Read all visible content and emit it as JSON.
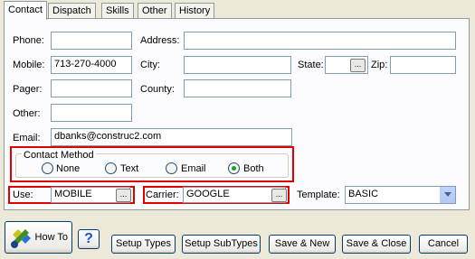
{
  "tabs": [
    "Contact",
    "Dispatch",
    "Skills",
    "Other",
    "History"
  ],
  "labels": {
    "phone": "Phone:",
    "address": "Address:",
    "mobile": "Mobile:",
    "city": "City:",
    "state": "State:",
    "zip": "Zip:",
    "pager": "Pager:",
    "county": "County:",
    "other": "Other:",
    "email": "Email:",
    "use": "Use:",
    "carrier": "Carrier:",
    "template": "Template:"
  },
  "values": {
    "phone": "",
    "address": "",
    "mobile": "713-270-4000",
    "city": "",
    "state": "",
    "zip": "",
    "pager": "",
    "county": "",
    "other": "",
    "email": "dbanks@construc2.com",
    "use": "MOBILE",
    "carrier": "GOOGLE",
    "template": "BASIC"
  },
  "browse_label": "...",
  "contact_method": {
    "title": "Contact Method",
    "options": [
      "None",
      "Text",
      "Email",
      "Both"
    ],
    "selected": "Both"
  },
  "buttons": {
    "how_to": "How To",
    "help": "?",
    "setup_types": "Setup Types",
    "setup_subtypes": "Setup SubTypes",
    "save_new": "Save & New",
    "save_close": "Save & Close",
    "cancel": "Cancel"
  },
  "colors": {
    "highlight": "#e00000",
    "accent": "#003c74",
    "help_icon": "#1a4ee0"
  }
}
